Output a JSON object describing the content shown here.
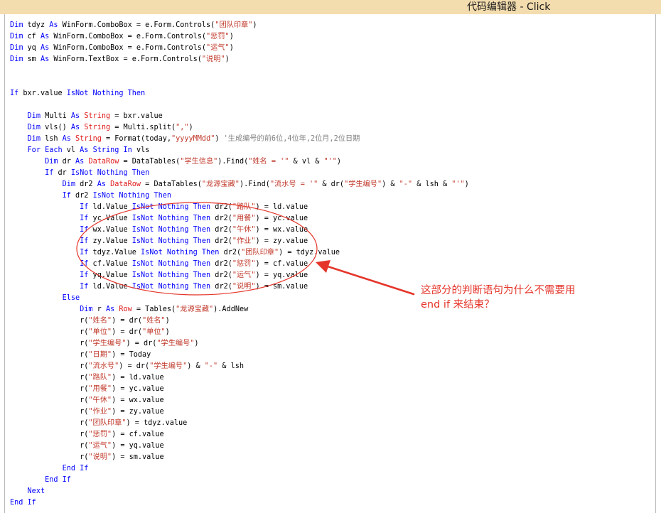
{
  "window": {
    "title": "代码编辑器 - Click"
  },
  "code_lines": [
    [
      {
        "t": "Dim",
        "c": "kw"
      },
      {
        "t": " tdyz "
      },
      {
        "t": "As",
        "c": "kw"
      },
      {
        "t": " WinForm.ComboBox = e.Form.Controls("
      },
      {
        "t": "\"团队印章\"",
        "c": "st"
      },
      {
        "t": ")"
      }
    ],
    [
      {
        "t": "Dim",
        "c": "kw"
      },
      {
        "t": " cf "
      },
      {
        "t": "As",
        "c": "kw"
      },
      {
        "t": " WinForm.ComboBox = e.Form.Controls("
      },
      {
        "t": "\"惩罚\"",
        "c": "st"
      },
      {
        "t": ")"
      }
    ],
    [
      {
        "t": "Dim",
        "c": "kw"
      },
      {
        "t": " yq "
      },
      {
        "t": "As",
        "c": "kw"
      },
      {
        "t": " WinForm.ComboBox = e.Form.Controls("
      },
      {
        "t": "\"运气\"",
        "c": "st"
      },
      {
        "t": ")"
      }
    ],
    [
      {
        "t": "Dim",
        "c": "kw"
      },
      {
        "t": " sm "
      },
      {
        "t": "As",
        "c": "kw"
      },
      {
        "t": " WinForm.TextBox = e.Form.Controls("
      },
      {
        "t": "\"说明\"",
        "c": "st"
      },
      {
        "t": ")"
      }
    ],
    [],
    [],
    [
      {
        "t": "If",
        "c": "kw"
      },
      {
        "t": " bxr.value "
      },
      {
        "t": "IsNot Nothing Then",
        "c": "kw"
      }
    ],
    [],
    [
      {
        "t": "    "
      },
      {
        "t": "Dim",
        "c": "kw"
      },
      {
        "t": " Multi "
      },
      {
        "t": "As",
        "c": "kw"
      },
      {
        "t": " "
      },
      {
        "t": "String",
        "c": "ty"
      },
      {
        "t": " = bxr.value"
      }
    ],
    [
      {
        "t": "    "
      },
      {
        "t": "Dim",
        "c": "kw"
      },
      {
        "t": " vls() "
      },
      {
        "t": "As",
        "c": "kw"
      },
      {
        "t": " "
      },
      {
        "t": "String",
        "c": "ty"
      },
      {
        "t": " = Multi.split("
      },
      {
        "t": "\",\"",
        "c": "st"
      },
      {
        "t": ")"
      }
    ],
    [
      {
        "t": "    "
      },
      {
        "t": "Dim",
        "c": "kw"
      },
      {
        "t": " lsh "
      },
      {
        "t": "As",
        "c": "kw"
      },
      {
        "t": " "
      },
      {
        "t": "String",
        "c": "ty"
      },
      {
        "t": " = Format(today,"
      },
      {
        "t": "\"yyyyMMdd\"",
        "c": "st"
      },
      {
        "t": ") "
      },
      {
        "t": "'生成编号的前6位,4位年,2位月,2位日期",
        "c": "cm"
      }
    ],
    [
      {
        "t": "    "
      },
      {
        "t": "For Each",
        "c": "kw"
      },
      {
        "t": " vl "
      },
      {
        "t": "As",
        "c": "kw"
      },
      {
        "t": " "
      },
      {
        "t": "String",
        "c": "kw"
      },
      {
        "t": " "
      },
      {
        "t": "In",
        "c": "kw"
      },
      {
        "t": " vls"
      }
    ],
    [
      {
        "t": "        "
      },
      {
        "t": "Dim",
        "c": "kw"
      },
      {
        "t": " dr "
      },
      {
        "t": "As",
        "c": "kw"
      },
      {
        "t": " "
      },
      {
        "t": "DataRow",
        "c": "ty"
      },
      {
        "t": " = DataTables("
      },
      {
        "t": "\"学生信息\"",
        "c": "st"
      },
      {
        "t": ").Find("
      },
      {
        "t": "\"姓名 = '\"",
        "c": "st"
      },
      {
        "t": " & vl & "
      },
      {
        "t": "\"'\"",
        "c": "st"
      },
      {
        "t": ")"
      }
    ],
    [
      {
        "t": "        "
      },
      {
        "t": "If",
        "c": "kw"
      },
      {
        "t": " dr "
      },
      {
        "t": "IsNot Nothing Then",
        "c": "kw"
      }
    ],
    [
      {
        "t": "            "
      },
      {
        "t": "Dim",
        "c": "kw"
      },
      {
        "t": " dr2 "
      },
      {
        "t": "As",
        "c": "kw"
      },
      {
        "t": " "
      },
      {
        "t": "DataRow",
        "c": "ty"
      },
      {
        "t": " = DataTables("
      },
      {
        "t": "\"龙源宝藏\"",
        "c": "st"
      },
      {
        "t": ").Find("
      },
      {
        "t": "\"流水号 = '\"",
        "c": "st"
      },
      {
        "t": " & dr("
      },
      {
        "t": "\"学生编号\"",
        "c": "st"
      },
      {
        "t": ") & "
      },
      {
        "t": "\"-\"",
        "c": "st"
      },
      {
        "t": " & lsh & "
      },
      {
        "t": "\"'\"",
        "c": "st"
      },
      {
        "t": ")"
      }
    ],
    [
      {
        "t": "            "
      },
      {
        "t": "If",
        "c": "kw"
      },
      {
        "t": " dr2 "
      },
      {
        "t": "IsNot Nothing Then",
        "c": "kw"
      }
    ],
    [
      {
        "t": "                "
      },
      {
        "t": "If",
        "c": "kw"
      },
      {
        "t": " ld.Value "
      },
      {
        "t": "IsNot Nothing Then",
        "c": "kw"
      },
      {
        "t": " dr2("
      },
      {
        "t": "\"路队\"",
        "c": "st"
      },
      {
        "t": ") = ld.value"
      }
    ],
    [
      {
        "t": "                "
      },
      {
        "t": "If",
        "c": "kw"
      },
      {
        "t": " yc.Value "
      },
      {
        "t": "IsNot Nothing Then",
        "c": "kw"
      },
      {
        "t": " dr2("
      },
      {
        "t": "\"用餐\"",
        "c": "st"
      },
      {
        "t": ") = yc.value"
      }
    ],
    [
      {
        "t": "                "
      },
      {
        "t": "If",
        "c": "kw"
      },
      {
        "t": " wx.Value "
      },
      {
        "t": "IsNot Nothing Then",
        "c": "kw"
      },
      {
        "t": " dr2("
      },
      {
        "t": "\"午休\"",
        "c": "st"
      },
      {
        "t": ") = wx.value"
      }
    ],
    [
      {
        "t": "                "
      },
      {
        "t": "If",
        "c": "kw"
      },
      {
        "t": " zy.Value "
      },
      {
        "t": "IsNot Nothing Then",
        "c": "kw"
      },
      {
        "t": " dr2("
      },
      {
        "t": "\"作业\"",
        "c": "st"
      },
      {
        "t": ") = zy.value"
      }
    ],
    [
      {
        "t": "                "
      },
      {
        "t": "If",
        "c": "kw"
      },
      {
        "t": " tdyz.Value "
      },
      {
        "t": "IsNot Nothing Then",
        "c": "kw"
      },
      {
        "t": " dr2("
      },
      {
        "t": "\"团队印章\"",
        "c": "st"
      },
      {
        "t": ") = tdyz.value"
      }
    ],
    [
      {
        "t": "                "
      },
      {
        "t": "If",
        "c": "kw"
      },
      {
        "t": " cf.Value "
      },
      {
        "t": "IsNot Nothing Then",
        "c": "kw"
      },
      {
        "t": " dr2("
      },
      {
        "t": "\"惩罚\"",
        "c": "st"
      },
      {
        "t": ") = cf.value"
      }
    ],
    [
      {
        "t": "                "
      },
      {
        "t": "If",
        "c": "kw"
      },
      {
        "t": " yq.Value "
      },
      {
        "t": "IsNot Nothing Then",
        "c": "kw"
      },
      {
        "t": " dr2("
      },
      {
        "t": "\"运气\"",
        "c": "st"
      },
      {
        "t": ") = yq.value"
      }
    ],
    [
      {
        "t": "                "
      },
      {
        "t": "If",
        "c": "kw"
      },
      {
        "t": " ld.Value "
      },
      {
        "t": "IsNot Nothing Then",
        "c": "kw"
      },
      {
        "t": " dr2("
      },
      {
        "t": "\"说明\"",
        "c": "st"
      },
      {
        "t": ") = sm.value"
      }
    ],
    [
      {
        "t": "            "
      },
      {
        "t": "Else",
        "c": "kw"
      }
    ],
    [
      {
        "t": "                "
      },
      {
        "t": "Dim",
        "c": "kw"
      },
      {
        "t": " r "
      },
      {
        "t": "As",
        "c": "kw"
      },
      {
        "t": " "
      },
      {
        "t": "Row",
        "c": "ty"
      },
      {
        "t": " = Tables("
      },
      {
        "t": "\"龙源宝藏\"",
        "c": "st"
      },
      {
        "t": ").AddNew"
      }
    ],
    [
      {
        "t": "                r("
      },
      {
        "t": "\"姓名\"",
        "c": "st"
      },
      {
        "t": ") = dr("
      },
      {
        "t": "\"姓名\"",
        "c": "st"
      },
      {
        "t": ")"
      }
    ],
    [
      {
        "t": "                r("
      },
      {
        "t": "\"单位\"",
        "c": "st"
      },
      {
        "t": ") = dr("
      },
      {
        "t": "\"单位\"",
        "c": "st"
      },
      {
        "t": ")"
      }
    ],
    [
      {
        "t": "                r("
      },
      {
        "t": "\"学生编号\"",
        "c": "st"
      },
      {
        "t": ") = dr("
      },
      {
        "t": "\"学生编号\"",
        "c": "st"
      },
      {
        "t": ")"
      }
    ],
    [
      {
        "t": "                r("
      },
      {
        "t": "\"日期\"",
        "c": "st"
      },
      {
        "t": ") = Today"
      }
    ],
    [
      {
        "t": "                r("
      },
      {
        "t": "\"流水号\"",
        "c": "st"
      },
      {
        "t": ") = dr("
      },
      {
        "t": "\"学生编号\"",
        "c": "st"
      },
      {
        "t": ") & "
      },
      {
        "t": "\"-\"",
        "c": "st"
      },
      {
        "t": " & lsh"
      }
    ],
    [
      {
        "t": "                r("
      },
      {
        "t": "\"路队\"",
        "c": "st"
      },
      {
        "t": ") = ld.value"
      }
    ],
    [
      {
        "t": "                r("
      },
      {
        "t": "\"用餐\"",
        "c": "st"
      },
      {
        "t": ") = yc.value"
      }
    ],
    [
      {
        "t": "                r("
      },
      {
        "t": "\"午休\"",
        "c": "st"
      },
      {
        "t": ") = wx.value"
      }
    ],
    [
      {
        "t": "                r("
      },
      {
        "t": "\"作业\"",
        "c": "st"
      },
      {
        "t": ") = zy.value"
      }
    ],
    [
      {
        "t": "                r("
      },
      {
        "t": "\"团队印章\"",
        "c": "st"
      },
      {
        "t": ") = tdyz.value"
      }
    ],
    [
      {
        "t": "                r("
      },
      {
        "t": "\"惩罚\"",
        "c": "st"
      },
      {
        "t": ") = cf.value"
      }
    ],
    [
      {
        "t": "                r("
      },
      {
        "t": "\"运气\"",
        "c": "st"
      },
      {
        "t": ") = yq.value"
      }
    ],
    [
      {
        "t": "                r("
      },
      {
        "t": "\"说明\"",
        "c": "st"
      },
      {
        "t": ") = sm.value"
      }
    ],
    [
      {
        "t": "            "
      },
      {
        "t": "End If",
        "c": "kw"
      }
    ],
    [
      {
        "t": "        "
      },
      {
        "t": "End If",
        "c": "kw"
      }
    ],
    [
      {
        "t": "    "
      },
      {
        "t": "Next",
        "c": "kw"
      }
    ],
    [
      {
        "t": "End If",
        "c": "kw"
      }
    ]
  ],
  "annotation": {
    "line1": "这部分的判断语句为什么不需要用",
    "line2": "end if 来结束？",
    "color": "#e5352a"
  },
  "colors": {
    "keyword": "#0000ff",
    "type": "#e01a1a",
    "string": "#c0392b",
    "comment": "#808080",
    "titlebar": "#f3dcae"
  }
}
